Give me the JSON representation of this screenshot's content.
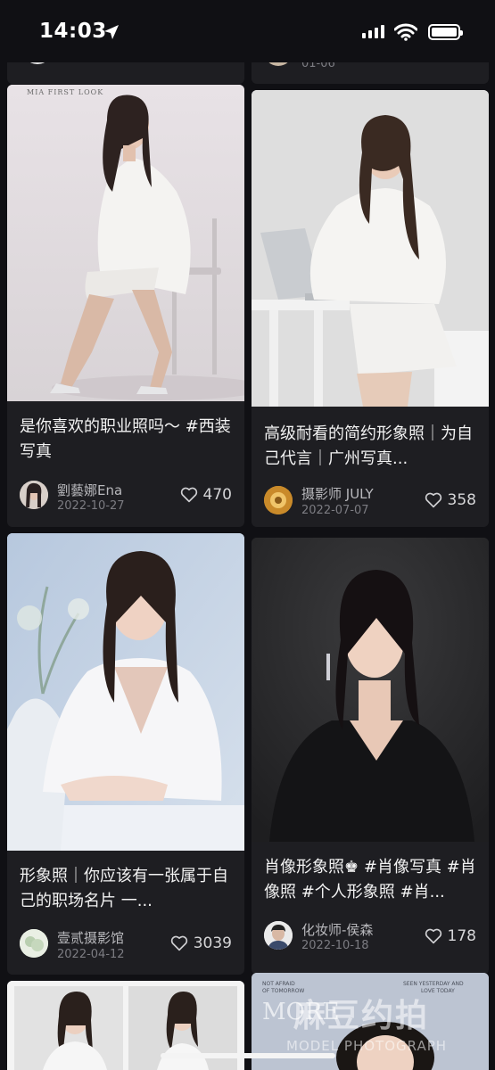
{
  "status_bar": {
    "time": "14:03"
  },
  "partial_card_right": {
    "date": "01-06"
  },
  "feed": [
    {
      "title": "是你喜欢的职业照吗～ #西装写真",
      "author": "劉藝娜Ena",
      "date": "2022-10-27",
      "likes": "470",
      "image_caption": "MIA FIRST LOOK"
    },
    {
      "title": "高级耐看的简约形象照｜为自己代言｜广州写真...",
      "author": "摄影师 JULY",
      "date": "2022-07-07",
      "likes": "358"
    },
    {
      "title": "形象照｜你应该有一张属于自己的职场名片 一...",
      "author": "壹贰摄影馆",
      "date": "2022-04-12",
      "likes": "3039"
    },
    {
      "title": "肖像形象照♚ #肖像写真 #肖像照 #个人形象照 #肖...",
      "author": "化妆师-侯森",
      "date": "2022-10-18",
      "likes": "178"
    }
  ],
  "watermark": {
    "brand": "麻豆约拍",
    "sub": "MODEL PHOTOGRAPH"
  },
  "colors": {
    "background": "#101014",
    "card": "#1e1e22"
  }
}
